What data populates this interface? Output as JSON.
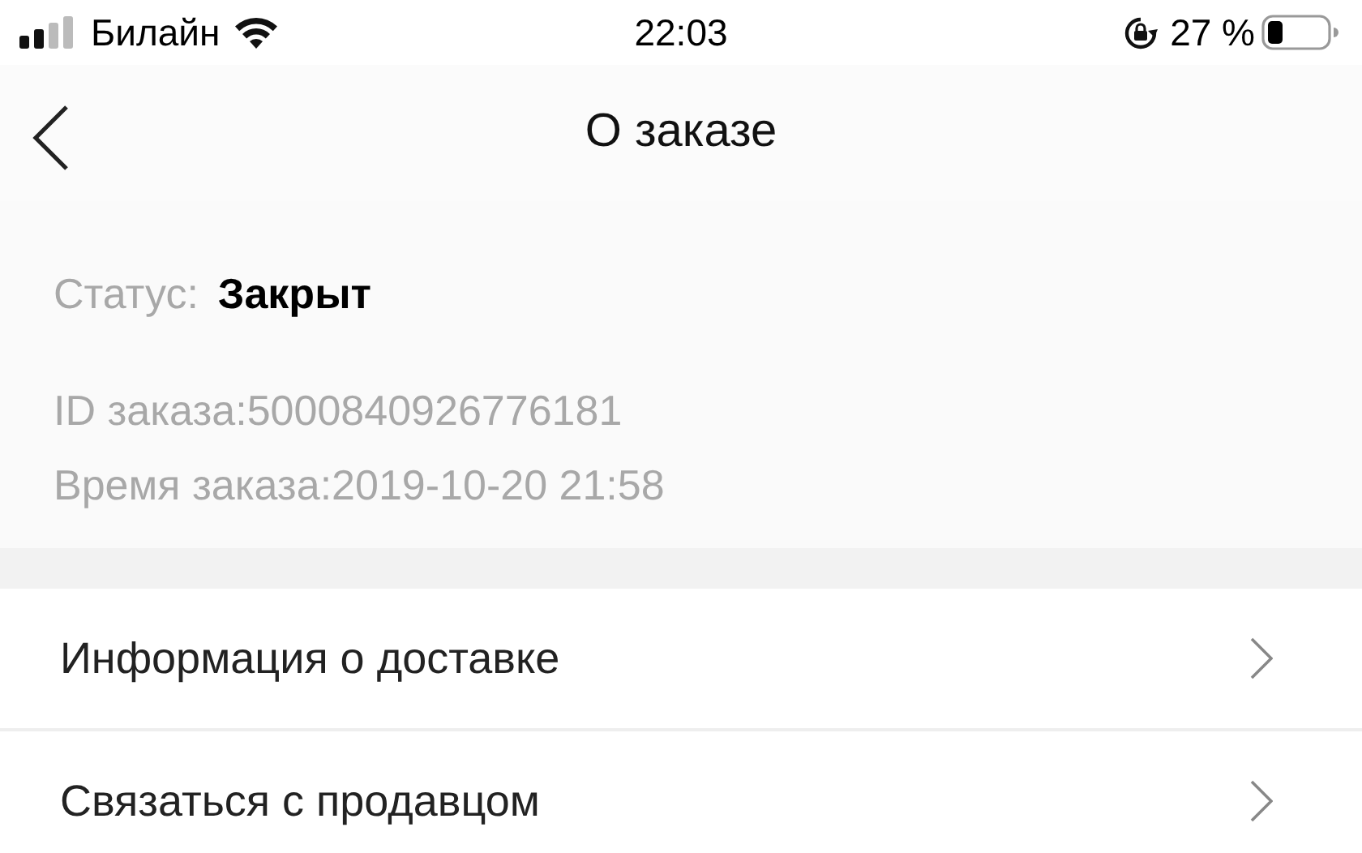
{
  "status_bar": {
    "carrier": "Билайн",
    "time": "22:03",
    "battery": "27 %"
  },
  "header": {
    "title": "О заказе"
  },
  "order": {
    "status_label": "Статус:",
    "status_value": "Закрыт",
    "id": "ID заказа:5000840926776181",
    "time": "Время заказа:2019-10-20 21:58"
  },
  "menu": [
    {
      "label": "Информация о доставке"
    },
    {
      "label": "Связаться с продавцом"
    }
  ]
}
